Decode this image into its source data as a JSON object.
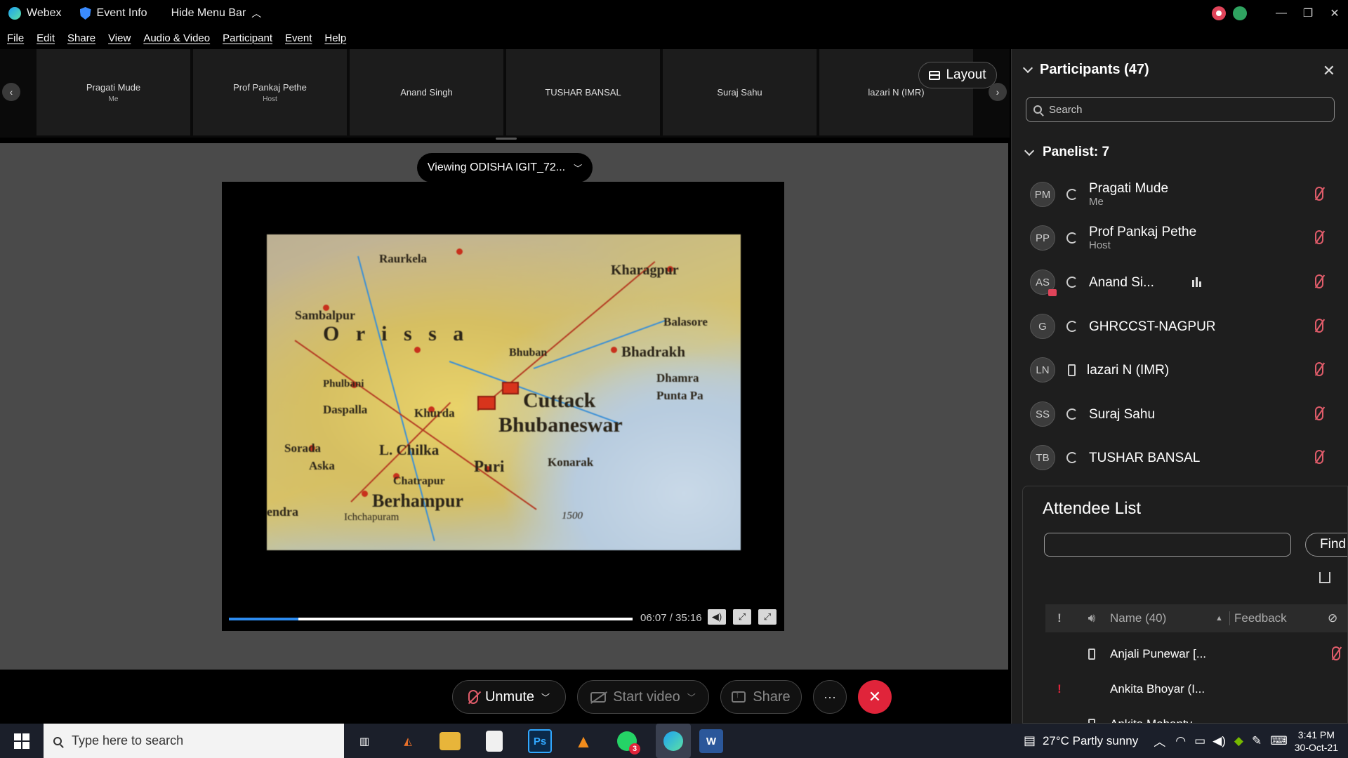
{
  "titlebar": {
    "app_name": "Webex",
    "event_info": "Event Info",
    "hide_menu": "Hide Menu Bar"
  },
  "menu": [
    "File",
    "Edit",
    "Share",
    "View",
    "Audio & Video",
    "Participant",
    "Event",
    "Help"
  ],
  "filmstrip": {
    "tiles": [
      {
        "name": "Pragati Mude",
        "role": "Me"
      },
      {
        "name": "Prof Pankaj Pethe",
        "role": "Host"
      },
      {
        "name": "Anand Singh",
        "role": ""
      },
      {
        "name": "TUSHAR BANSAL",
        "role": ""
      },
      {
        "name": "Suraj Sahu",
        "role": ""
      },
      {
        "name": "lazari N (IMR)",
        "role": ""
      }
    ],
    "layout_label": "Layout"
  },
  "stage": {
    "viewing_label": "Viewing ODISHA IGIT_72...",
    "map_labels": {
      "raurkela": "Raurkela",
      "kharagpur": "Kharagpur",
      "sambalpur": "Sambalpur",
      "orissa": "O r i s s a",
      "balasore": "Balasore",
      "bhadrakh": "Bhadrakh",
      "bhuban": "Bhuban",
      "dhamra": "Dhamra",
      "punta": "Punta Pa",
      "phulbani": "Phulbani",
      "khurda": "Khurda",
      "daspalla": "Daspalla",
      "cuttack": "Cuttack",
      "bhubaneswar": "Bhubaneswar",
      "sorada": "Sorada",
      "aska": "Aska",
      "chilka": "L. Chilka",
      "puri": "Puri",
      "konarak": "Konarak",
      "chatrapur": "Chatrapur",
      "berhampur": "Berhampur",
      "endra": "endra",
      "ichchapuram": "Ichchapuram",
      "scale": "1500"
    },
    "progress_fraction": 0.172,
    "time_current": "06:07",
    "time_total": "35:16",
    "time_display": "06:07 / 35:16"
  },
  "controls": {
    "unmute": "Unmute",
    "start_video": "Start video",
    "share": "Share",
    "more": "···",
    "leave": "✕"
  },
  "participants": {
    "header": "Participants (47)",
    "search_placeholder": "Search",
    "panelist_header": "Panelist: 7",
    "panelists": [
      {
        "initials": "PM",
        "name": "Pragati Mude",
        "role": "Me",
        "device": "sync-icon"
      },
      {
        "initials": "PP",
        "name": "Prof Pankaj Pethe",
        "role": "Host",
        "device": "sync-icon"
      },
      {
        "initials": "AS",
        "name": "Anand Si...",
        "role": "",
        "device": "sync-icon"
      },
      {
        "initials": "G",
        "name": "GHRCCST-NAGPUR",
        "role": "",
        "device": "sync-icon"
      },
      {
        "initials": "LN",
        "name": "lazari N (IMR)",
        "role": "",
        "device": "phone-icon"
      },
      {
        "initials": "SS",
        "name": "Suraj Sahu",
        "role": "",
        "device": "sync-icon"
      },
      {
        "initials": "TB",
        "name": "TUSHAR BANSAL",
        "role": "",
        "device": "sync-icon"
      }
    ]
  },
  "attendees": {
    "title": "Attendee List",
    "find_label": "Find",
    "col_alert": "!",
    "col_name": "Name (40)",
    "col_feedback": "Feedback",
    "rows": [
      {
        "alert": "",
        "name": "Anjali Punewar [..."
      },
      {
        "alert": "!",
        "name": "Ankita Bhoyar (I..."
      },
      {
        "alert": "",
        "name": "Ankita Mohanty"
      }
    ]
  },
  "taskbar": {
    "search_placeholder": "Type here to search",
    "badge_count": "3",
    "weather": "27°C  Partly sunny",
    "time": "3:41 PM",
    "date": "30-Oct-21",
    "apps": [
      "task-view-icon",
      "matlab-icon",
      "file-explorer-icon",
      "document-icon",
      "photoshop-icon",
      "vlc-icon",
      "whatsapp-icon",
      "webex-icon",
      "word-icon"
    ]
  },
  "colors": {
    "accent": "#2d8cf0",
    "muted_red": "#e05c6a",
    "leave_red": "#e0243a",
    "stage_bg": "#4a4a4a",
    "panel_bg": "#1e1e1e"
  }
}
